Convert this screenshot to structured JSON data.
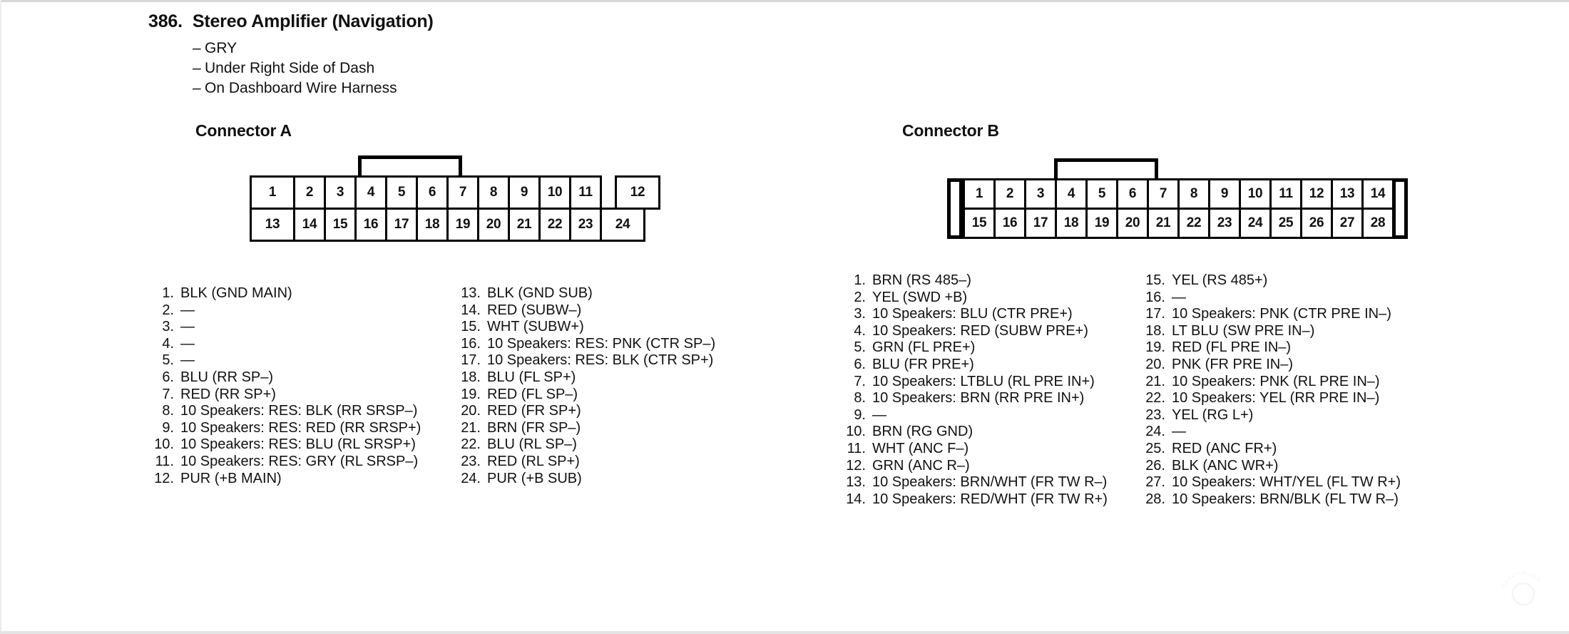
{
  "header": {
    "number": "386.",
    "title": "Stereo Amplifier (Navigation)",
    "notes": [
      "GRY",
      "Under Right Side of Dash",
      "On Dashboard Wire Harness"
    ],
    "dash": "–"
  },
  "watermark": {
    "text": "the12volt.com"
  },
  "connector_a": {
    "heading": "Connector A",
    "diagram": {
      "top_row": [
        "1",
        "2",
        "3",
        "4",
        "5",
        "6",
        "7",
        "8",
        "9",
        "10",
        "11",
        "12"
      ],
      "bottom_row": [
        "13",
        "14",
        "15",
        "16",
        "17",
        "18",
        "19",
        "20",
        "21",
        "22",
        "23",
        "24"
      ]
    },
    "pins_left": [
      {
        "num": "1.",
        "desc": "BLK (GND MAIN)"
      },
      {
        "num": "2.",
        "desc": "—"
      },
      {
        "num": "3.",
        "desc": "—"
      },
      {
        "num": "4.",
        "desc": "—"
      },
      {
        "num": "5.",
        "desc": "—"
      },
      {
        "num": "6.",
        "desc": "BLU (RR SP–)"
      },
      {
        "num": "7.",
        "desc": "RED (RR SP+)"
      },
      {
        "num": "8.",
        "desc": "10 Speakers: RES: BLK (RR SRSP–)"
      },
      {
        "num": "9.",
        "desc": "10 Speakers: RES: RED (RR SRSP+)"
      },
      {
        "num": "10.",
        "desc": "10 Speakers: RES: BLU (RL SRSP+)"
      },
      {
        "num": "11.",
        "desc": "10 Speakers: RES: GRY (RL SRSP–)"
      },
      {
        "num": "12.",
        "desc": "PUR (+B MAIN)"
      }
    ],
    "pins_right": [
      {
        "num": "13.",
        "desc": "BLK (GND SUB)"
      },
      {
        "num": "14.",
        "desc": "RED (SUBW–)"
      },
      {
        "num": "15.",
        "desc": "WHT (SUBW+)"
      },
      {
        "num": "16.",
        "desc": "10 Speakers: RES: PNK (CTR SP–)"
      },
      {
        "num": "17.",
        "desc": "10 Speakers: RES: BLK (CTR SP+)"
      },
      {
        "num": "18.",
        "desc": "BLU (FL SP+)"
      },
      {
        "num": "19.",
        "desc": "RED (FL SP–)"
      },
      {
        "num": "20.",
        "desc": "RED (FR SP+)"
      },
      {
        "num": "21.",
        "desc": "BRN (FR SP–)"
      },
      {
        "num": "22.",
        "desc": "BLU (RL SP–)"
      },
      {
        "num": "23.",
        "desc": "RED (RL SP+)"
      },
      {
        "num": "24.",
        "desc": "PUR (+B SUB)"
      }
    ]
  },
  "connector_b": {
    "heading": "Connector B",
    "diagram": {
      "top_row": [
        "1",
        "2",
        "3",
        "4",
        "5",
        "6",
        "7",
        "8",
        "9",
        "10",
        "11",
        "12",
        "13",
        "14"
      ],
      "bottom_row": [
        "15",
        "16",
        "17",
        "18",
        "19",
        "20",
        "21",
        "22",
        "23",
        "24",
        "25",
        "26",
        "27",
        "28"
      ]
    },
    "pins_left": [
      {
        "num": "1.",
        "desc": "BRN (RS 485–)"
      },
      {
        "num": "2.",
        "desc": "YEL (SWD +B)"
      },
      {
        "num": "3.",
        "desc": "10 Speakers: BLU (CTR PRE+)"
      },
      {
        "num": "4.",
        "desc": "10 Speakers: RED (SUBW PRE+)"
      },
      {
        "num": "5.",
        "desc": "GRN (FL PRE+)"
      },
      {
        "num": "6.",
        "desc": "BLU (FR PRE+)"
      },
      {
        "num": "7.",
        "desc": "10 Speakers: LTBLU  (RL PRE IN+)"
      },
      {
        "num": "8.",
        "desc": "10 Speakers: BRN (RR PRE IN+)"
      },
      {
        "num": "9.",
        "desc": "—"
      },
      {
        "num": "10.",
        "desc": "BRN (RG GND)"
      },
      {
        "num": "11.",
        "desc": "WHT (ANC F–)"
      },
      {
        "num": "12.",
        "desc": "GRN (ANC R–)"
      },
      {
        "num": "13.",
        "desc": "10 Speakers: BRN/WHT (FR TW R–)"
      },
      {
        "num": "14.",
        "desc": "10 Speakers: RED/WHT (FR TW R+)"
      }
    ],
    "pins_right": [
      {
        "num": "15.",
        "desc": "YEL (RS 485+)"
      },
      {
        "num": "16.",
        "desc": "—"
      },
      {
        "num": "17.",
        "desc": "10 Speakers: PNK (CTR PRE IN–)"
      },
      {
        "num": "18.",
        "desc": "LT BLU (SW PRE IN–)"
      },
      {
        "num": "19.",
        "desc": "RED (FL PRE IN–)"
      },
      {
        "num": "20.",
        "desc": "PNK (FR PRE IN–)"
      },
      {
        "num": "21.",
        "desc": "10 Speakers: PNK (RL PRE IN–)"
      },
      {
        "num": "22.",
        "desc": "10 Speakers: YEL (RR PRE IN–)"
      },
      {
        "num": "23.",
        "desc": "YEL (RG L+)"
      },
      {
        "num": "24.",
        "desc": "—"
      },
      {
        "num": "25.",
        "desc": "RED (ANC FR+)"
      },
      {
        "num": "26.",
        "desc": "BLK (ANC WR+)"
      },
      {
        "num": "27.",
        "desc": "10 Speakers: WHT/YEL (FL TW R+)"
      },
      {
        "num": "28.",
        "desc": "10 Speakers: BRN/BLK (FL TW R–)"
      }
    ]
  }
}
